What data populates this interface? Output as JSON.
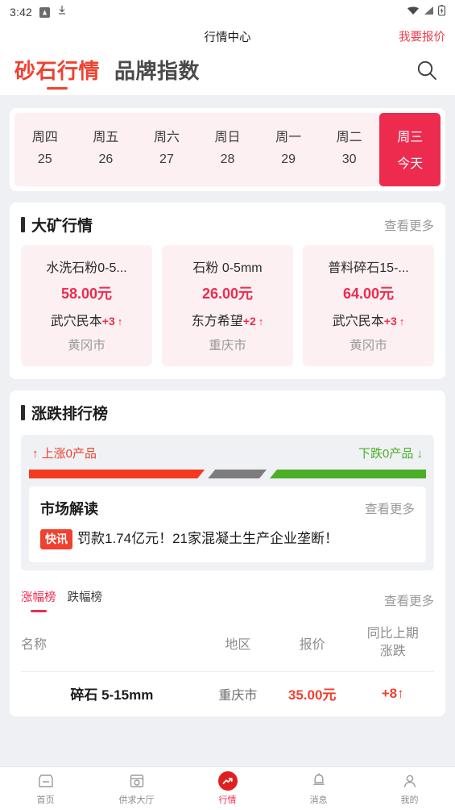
{
  "statusbar": {
    "time": "3:42",
    "icons": [
      "app-badge-icon",
      "download-icon",
      "wifi-icon",
      "signal-icon",
      "battery-charging-icon"
    ]
  },
  "titlebar": {
    "title": "行情中心",
    "action_label": "我要报价"
  },
  "header": {
    "tabs": [
      {
        "label": "砂石行情",
        "active": true
      },
      {
        "label": "品牌指数",
        "active": false
      }
    ],
    "search_icon": "search-icon"
  },
  "dates": [
    {
      "week": "周四",
      "day": "25",
      "today": false
    },
    {
      "week": "周五",
      "day": "26",
      "today": false
    },
    {
      "week": "周六",
      "day": "27",
      "today": false
    },
    {
      "week": "周日",
      "day": "28",
      "today": false
    },
    {
      "week": "周一",
      "day": "29",
      "today": false
    },
    {
      "week": "周二",
      "day": "30",
      "today": false
    },
    {
      "week": "周三",
      "day": "今天",
      "today": true
    }
  ],
  "mine_section": {
    "title": "大矿行情",
    "more_label": "查看更多",
    "cards": [
      {
        "name": "水洗石粉0-5...",
        "price": "58.00元",
        "supplier": "武穴民本",
        "delta": "+3",
        "arrow": "↑",
        "city": "黄冈市"
      },
      {
        "name": "石粉 0-5mm",
        "price": "26.00元",
        "supplier": "东方希望",
        "delta": "+2",
        "arrow": "↑",
        "city": "重庆市"
      },
      {
        "name": "普料碎石15-...",
        "price": "64.00元",
        "supplier": "武穴民本",
        "delta": "+3",
        "arrow": "↑",
        "city": "黄冈市"
      }
    ]
  },
  "rank_section": {
    "title": "涨跌排行榜",
    "up_label": "↑ 上涨0产品",
    "down_label": "下跌0产品 ↓",
    "bar": {
      "up_color": "#f43a21",
      "flat_color": "#7d7d7d",
      "down_color": "#4caf27",
      "up_pct": 45,
      "flat_pct": 15,
      "down_pct": 40
    },
    "news": {
      "title": "市场解读",
      "more_label": "查看更多",
      "badge": "快讯",
      "text": "罚款1.74亿元！21家混凝土生产企业垄断！"
    },
    "subtabs": [
      {
        "label": "涨幅榜",
        "active": true
      },
      {
        "label": "跌幅榜",
        "active": false
      }
    ],
    "subtabs_more": "查看更多",
    "table": {
      "headers": [
        "名称",
        "地区",
        "报价",
        "同比上期涨跌"
      ],
      "header_change_line1": "同比上期",
      "header_change_line2": "涨跌",
      "rows": [
        {
          "name": "碎石 5-15mm",
          "region": "重庆市",
          "price": "35.00元",
          "change": "+8↑"
        }
      ]
    }
  },
  "bottomnav": [
    {
      "label": "首页",
      "icon": "home-shop-icon",
      "active": false
    },
    {
      "label": "供求大厅",
      "icon": "supply-hall-icon",
      "active": false
    },
    {
      "label": "行情",
      "icon": "market-trend-icon",
      "active": true
    },
    {
      "label": "消息",
      "icon": "bell-icon",
      "active": false
    },
    {
      "label": "我的",
      "icon": "user-icon",
      "active": false
    }
  ]
}
